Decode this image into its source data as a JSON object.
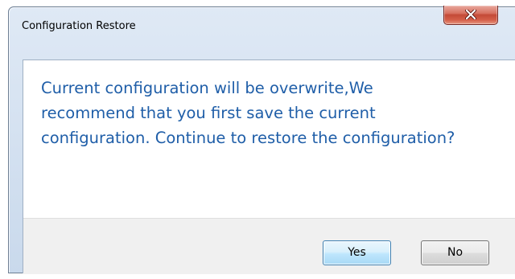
{
  "dialog": {
    "title": "Configuration Restore",
    "message": "Current configuration will be overwrite,We recommend that you first save the current configuration. Continue to restore the configuration?",
    "close_icon": "close-x-icon",
    "buttons": {
      "yes_label": "Yes",
      "no_label": "No"
    },
    "colors": {
      "message_text": "#1f5ea8",
      "close_button": "#c44a37",
      "default_button_border": "#3c7fb1"
    }
  }
}
